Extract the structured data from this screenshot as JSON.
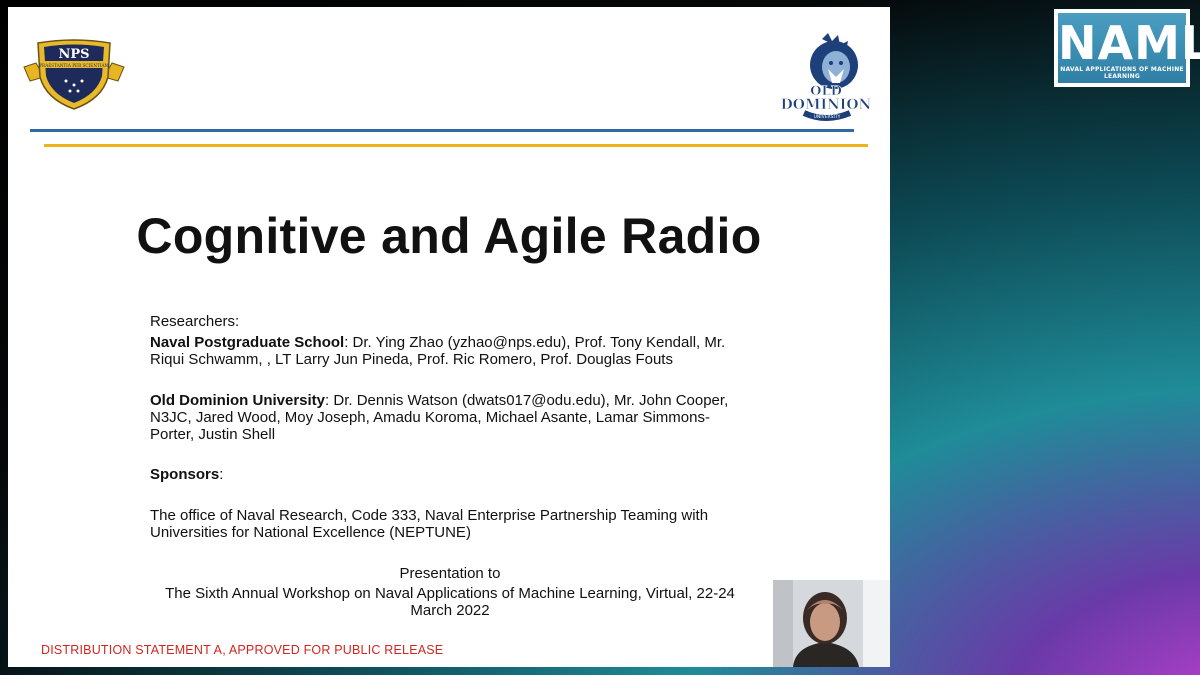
{
  "slide": {
    "title": "Cognitive and Agile Radio",
    "researchers_heading": "Researchers",
    "nps_org": "Naval Postgraduate School",
    "nps_line1": ": Dr. Ying Zhao (yzhao@nps.edu), Prof.  Tony Kendall, Mr.",
    "nps_line2": "Riqui Schwamm, , LT Larry Jun Pineda, Prof. Ric Romero, Prof. Douglas Fouts",
    "odu_org": "Old Dominion University",
    "odu_line1": ": Dr. Dennis Watson (dwats017@odu.edu), Mr. John Cooper,",
    "odu_line2": "N3JC, Jared Wood, Moy Joseph, Amadu Koroma, Michael Asante, Lamar Simmons-",
    "odu_line3": "Porter, Justin Shell",
    "sponsors_heading": "Sponsors",
    "sponsor_line1": "The office of Naval Research, Code 333, Naval Enterprise Partnership Teaming with",
    "sponsor_line2": "Universities for National Excellence (NEPTUNE)",
    "presentation_line1": "Presentation to",
    "presentation_line2": "The Sixth Annual Workshop on Naval Applications of Machine Learning, Virtual, 22-24",
    "presentation_line3": "March 2022",
    "distribution": "DISTRIBUTION STATEMENT A, APPROVED FOR PUBLIC RELEASE",
    "nps_logo_text": "NPS",
    "nps_logo_motto": "PRAESTANTIA PER SCIENTIAM",
    "odu_logo_text": "OLD DOMINION",
    "odu_logo_sub": "UNIVERSITY"
  },
  "overlay": {
    "naml_letters": "NAML",
    "naml_sub": "NAVAL APPLICATIONS OF MACHINE LEARNING"
  },
  "colors": {
    "rule_blue": "#2d6aa6",
    "rule_gold": "#f2b21c",
    "distribution_red": "#d0261f",
    "naml_blue": "#3a8fb5"
  }
}
